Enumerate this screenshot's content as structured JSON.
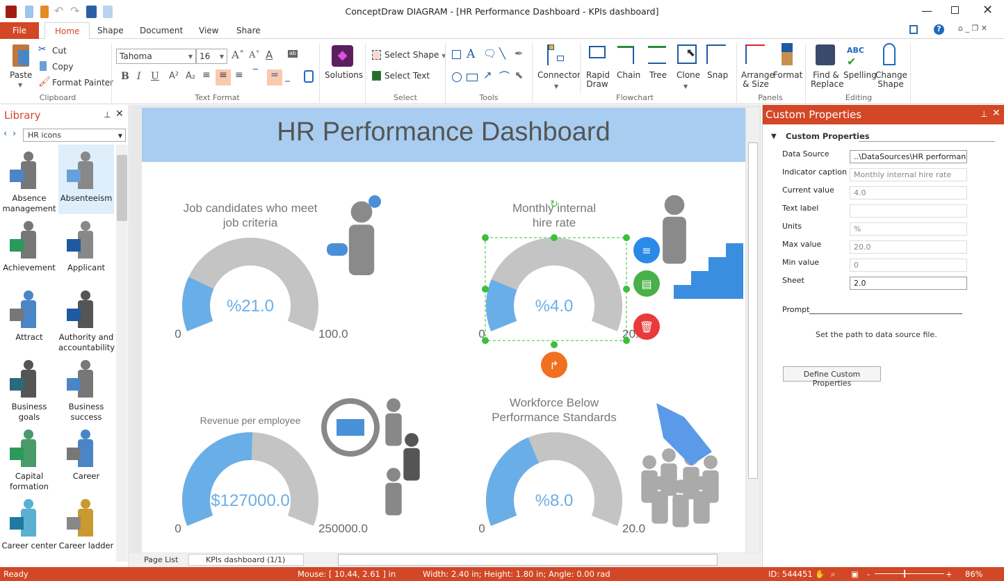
{
  "window": {
    "title": "ConceptDraw DIAGRAM - [HR Performance Dashboard - KPIs dashboard]"
  },
  "tabs": [
    {
      "label": "File"
    },
    {
      "label": "Home"
    },
    {
      "label": "Shape"
    },
    {
      "label": "Document"
    },
    {
      "label": "View"
    },
    {
      "label": "Share"
    }
  ],
  "ribbon": {
    "clipboard": {
      "paste": "Paste",
      "cut": "Cut",
      "copy": "Copy",
      "format_painter": "Format Painter",
      "group": "Clipboard"
    },
    "text_format": {
      "font": "Tahoma",
      "size": "16",
      "group": "Text Format"
    },
    "solutions": {
      "label": "Solutions"
    },
    "select": {
      "select_shape": "Select Shape",
      "select_text": "Select Text",
      "group": "Select"
    },
    "tools": {
      "group": "Tools"
    },
    "flowchart": {
      "connector": "Connector",
      "rapid_draw": "Rapid Draw",
      "chain": "Chain",
      "tree": "Tree",
      "clone": "Clone",
      "snap": "Snap",
      "group": "Flowchart"
    },
    "panels": {
      "arrange": "Arrange & Size",
      "format": "Format",
      "group": "Panels"
    },
    "editing": {
      "find": "Find & Replace",
      "spelling": "Spelling",
      "change_shape": "Change Shape",
      "group": "Editing"
    }
  },
  "library": {
    "title": "Library",
    "selected": "HR icons",
    "items": [
      {
        "label": "Absence management"
      },
      {
        "label": "Absenteeism"
      },
      {
        "label": "Achievement"
      },
      {
        "label": "Applicant"
      },
      {
        "label": "Attract"
      },
      {
        "label": "Authority and accountability"
      },
      {
        "label": "Business goals"
      },
      {
        "label": "Business success"
      },
      {
        "label": "Capital formation"
      },
      {
        "label": "Career"
      },
      {
        "label": "Career center"
      },
      {
        "label": "Career ladder"
      }
    ]
  },
  "canvas": {
    "title": "HR Performance Dashboard",
    "page_list": "Page List",
    "page_select": "KPIs dashboard (1/1)"
  },
  "gauges": [
    {
      "caption": "Job candidates who meet job criteria",
      "value": 21,
      "min": 0,
      "max": 100,
      "display": "%21.0",
      "min_label": "0",
      "max_label": "100.0"
    },
    {
      "caption": "Monthly internal hire rate",
      "value": 4,
      "min": 0,
      "max": 20,
      "display": "%4.0",
      "min_label": "0",
      "max_label": "20.0"
    },
    {
      "caption": "Revenue per employee",
      "value": 127000,
      "min": 0,
      "max": 250000,
      "display": "$127000.0",
      "min_label": "0",
      "max_label": "250000.0"
    },
    {
      "caption": "Workforce Below Performance Standards",
      "value": 8,
      "min": 0,
      "max": 20,
      "display": "%8.0",
      "min_label": "0",
      "max_label": "20.0"
    }
  ],
  "colors": {
    "accent": "#d24726",
    "gauge_fill": "#6aaee8",
    "gauge_track": "#c4c4c4",
    "header_band": "#a8cdf0"
  },
  "properties": {
    "title": "Custom Properties",
    "section": "Custom Properties",
    "fields": [
      {
        "label": "Data Source",
        "value": "..\\DataSources\\HR performance.:"
      },
      {
        "label": "Indicator caption",
        "value": "Monthly internal hire rate"
      },
      {
        "label": "Current value",
        "value": "4.0"
      },
      {
        "label": "Text label",
        "value": ""
      },
      {
        "label": "Units",
        "value": "%"
      },
      {
        "label": "Max value",
        "value": "20.0"
      },
      {
        "label": "Min value",
        "value": "0"
      },
      {
        "label": "Sheet",
        "value": "2.0"
      }
    ],
    "prompt": "Prompt",
    "hint": "Set the path to data source file.",
    "define_button": "Define Custom Properties"
  },
  "status": {
    "ready": "Ready",
    "mouse": "Mouse: [ 10.44, 2.61 ] in",
    "size": "Width: 2.40 in;  Height: 1.80 in;  Angle: 0.00 rad",
    "id": "ID: 544451",
    "zoom": "86%"
  }
}
